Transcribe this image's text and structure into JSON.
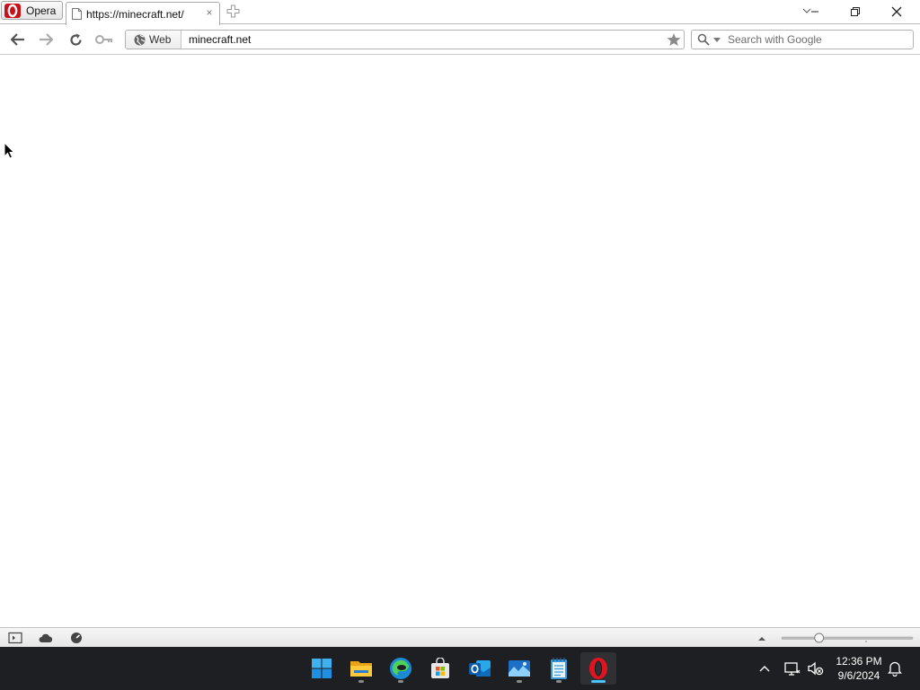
{
  "browser": {
    "menu_label": "Opera",
    "tab": {
      "title": "https://minecraft.net/",
      "close_glyph": "×"
    },
    "window_controls": [
      "tab-list",
      "minimize",
      "restore",
      "close"
    ]
  },
  "toolbar": {
    "buttons": [
      "back-icon",
      "forward-icon",
      "reload-icon",
      "wand-key-icon"
    ],
    "address": {
      "badge_label": "Web",
      "value": "minecraft.net"
    },
    "search": {
      "placeholder": "Search with Google"
    }
  },
  "statusbar": {
    "icons": [
      "panel-toggle-icon",
      "turbo-cloud-icon",
      "speed-dial-icon",
      "zoom-menu-icon"
    ],
    "zoom_percent": 100
  },
  "taskbar": {
    "apps": [
      "windows-start",
      "file-explorer",
      "edge",
      "microsoft-store",
      "outlook",
      "photos",
      "notepad",
      "opera"
    ],
    "active_app": "opera",
    "clock": {
      "time": "12:36 PM",
      "date": "9/6/2024"
    }
  },
  "colors": {
    "opera_red": "#cc0f16",
    "taskbar_bg": "#1e1f22",
    "active_indicator": "#4cc2ff"
  }
}
